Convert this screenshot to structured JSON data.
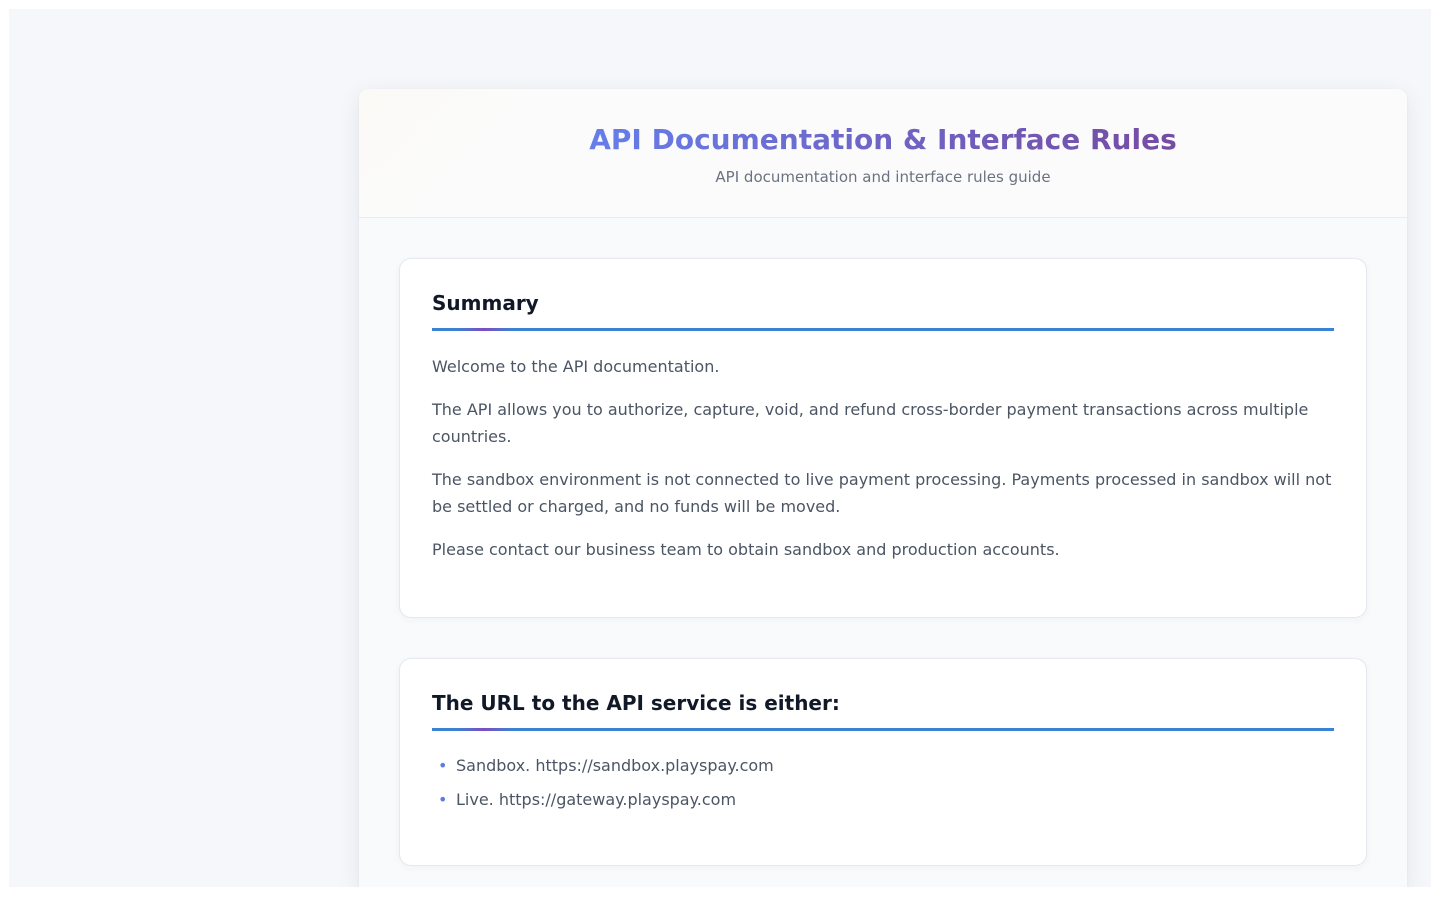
{
  "header": {
    "title": "API Documentation & Interface Rules",
    "subtitle": "API documentation and interface rules guide"
  },
  "summary": {
    "title": "Summary",
    "paragraphs": [
      "Welcome to the API documentation.",
      "The API allows you to authorize, capture, void, and refund cross-border payment transactions across multiple countries.",
      "The sandbox environment is not connected to live payment processing. Payments processed in sandbox will not be settled or charged, and no funds will be moved.",
      "Please contact our business team to obtain sandbox and production accounts."
    ]
  },
  "urls": {
    "title": "The URL to the API service is either:",
    "items": [
      "Sandbox. https://sandbox.playspay.com",
      "Live. https://gateway.playspay.com"
    ]
  },
  "colors": {
    "title_gradient_start": "#667eea",
    "title_gradient_end": "#764ba2",
    "accent_line": "#3b82d6",
    "bullet": "#5b7fe0"
  }
}
